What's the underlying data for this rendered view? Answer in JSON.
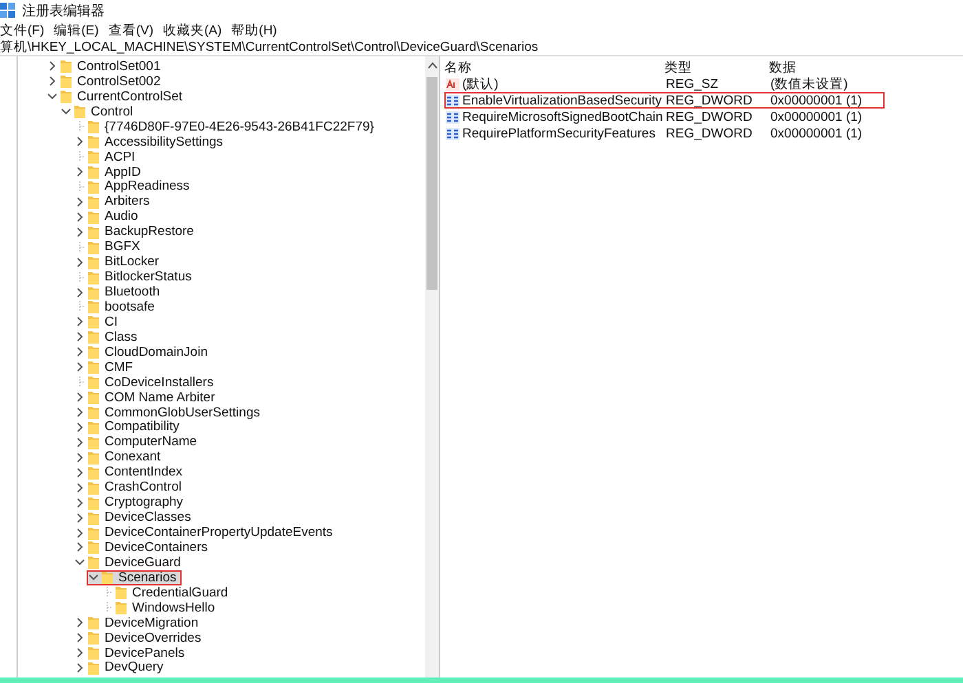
{
  "window": {
    "title": "注册表编辑器"
  },
  "menu": [
    "文件(F)",
    "编辑(E)",
    "查看(V)",
    "收藏夹(A)",
    "帮助(H)"
  ],
  "address": "算机\\HKEY_LOCAL_MACHINE\\SYSTEM\\CurrentControlSet\\Control\\DeviceGuard\\Scenarios",
  "tree": [
    {
      "label": "ControlSet001",
      "expandable": true,
      "expanded": false,
      "selected": false,
      "highlighted": false
    },
    {
      "label": "ControlSet002",
      "expandable": true,
      "expanded": false,
      "selected": false,
      "highlighted": false
    },
    {
      "label": "CurrentControlSet",
      "expandable": true,
      "expanded": true,
      "selected": false,
      "highlighted": false,
      "children": [
        {
          "label": "Control",
          "expandable": true,
          "expanded": true,
          "selected": false,
          "highlighted": false,
          "children": [
            {
              "label": "{7746D80F-97E0-4E26-9543-26B41FC22F79}",
              "expandable": false,
              "selected": false,
              "highlighted": false
            },
            {
              "label": "AccessibilitySettings",
              "expandable": true,
              "expanded": false,
              "selected": false,
              "highlighted": false
            },
            {
              "label": "ACPI",
              "expandable": false,
              "selected": false,
              "highlighted": false
            },
            {
              "label": "AppID",
              "expandable": true,
              "expanded": false,
              "selected": false,
              "highlighted": false
            },
            {
              "label": "AppReadiness",
              "expandable": false,
              "selected": false,
              "highlighted": false
            },
            {
              "label": "Arbiters",
              "expandable": true,
              "expanded": false,
              "selected": false,
              "highlighted": false
            },
            {
              "label": "Audio",
              "expandable": true,
              "expanded": false,
              "selected": false,
              "highlighted": false
            },
            {
              "label": "BackupRestore",
              "expandable": true,
              "expanded": false,
              "selected": false,
              "highlighted": false
            },
            {
              "label": "BGFX",
              "expandable": false,
              "selected": false,
              "highlighted": false
            },
            {
              "label": "BitLocker",
              "expandable": true,
              "expanded": false,
              "selected": false,
              "highlighted": false
            },
            {
              "label": "BitlockerStatus",
              "expandable": false,
              "selected": false,
              "highlighted": false
            },
            {
              "label": "Bluetooth",
              "expandable": true,
              "expanded": false,
              "selected": false,
              "highlighted": false
            },
            {
              "label": "bootsafe",
              "expandable": false,
              "selected": false,
              "highlighted": false
            },
            {
              "label": "CI",
              "expandable": true,
              "expanded": false,
              "selected": false,
              "highlighted": false
            },
            {
              "label": "Class",
              "expandable": true,
              "expanded": false,
              "selected": false,
              "highlighted": false
            },
            {
              "label": "CloudDomainJoin",
              "expandable": true,
              "expanded": false,
              "selected": false,
              "highlighted": false
            },
            {
              "label": "CMF",
              "expandable": true,
              "expanded": false,
              "selected": false,
              "highlighted": false
            },
            {
              "label": "CoDeviceInstallers",
              "expandable": false,
              "selected": false,
              "highlighted": false
            },
            {
              "label": "COM Name Arbiter",
              "expandable": true,
              "expanded": false,
              "selected": false,
              "highlighted": false
            },
            {
              "label": "CommonGlobUserSettings",
              "expandable": true,
              "expanded": false,
              "selected": false,
              "highlighted": false
            },
            {
              "label": "Compatibility",
              "expandable": true,
              "expanded": false,
              "selected": false,
              "highlighted": false
            },
            {
              "label": "ComputerName",
              "expandable": true,
              "expanded": false,
              "selected": false,
              "highlighted": false
            },
            {
              "label": "Conexant",
              "expandable": true,
              "expanded": false,
              "selected": false,
              "highlighted": false
            },
            {
              "label": "ContentIndex",
              "expandable": true,
              "expanded": false,
              "selected": false,
              "highlighted": false
            },
            {
              "label": "CrashControl",
              "expandable": true,
              "expanded": false,
              "selected": false,
              "highlighted": false
            },
            {
              "label": "Cryptography",
              "expandable": true,
              "expanded": false,
              "selected": false,
              "highlighted": false
            },
            {
              "label": "DeviceClasses",
              "expandable": true,
              "expanded": false,
              "selected": false,
              "highlighted": false
            },
            {
              "label": "DeviceContainerPropertyUpdateEvents",
              "expandable": true,
              "expanded": false,
              "selected": false,
              "highlighted": false
            },
            {
              "label": "DeviceContainers",
              "expandable": true,
              "expanded": false,
              "selected": false,
              "highlighted": false
            },
            {
              "label": "DeviceGuard",
              "expandable": true,
              "expanded": true,
              "selected": false,
              "highlighted": false,
              "children": [
                {
                  "label": "Scenarios",
                  "expandable": true,
                  "expanded": true,
                  "selected": true,
                  "highlighted": true,
                  "children": [
                    {
                      "label": "CredentialGuard",
                      "expandable": false,
                      "selected": false,
                      "highlighted": false
                    },
                    {
                      "label": "WindowsHello",
                      "expandable": false,
                      "selected": false,
                      "highlighted": false
                    }
                  ]
                }
              ]
            },
            {
              "label": "DeviceMigration",
              "expandable": true,
              "expanded": false,
              "selected": false,
              "highlighted": false
            },
            {
              "label": "DeviceOverrides",
              "expandable": true,
              "expanded": false,
              "selected": false,
              "highlighted": false
            },
            {
              "label": "DevicePanels",
              "expandable": true,
              "expanded": false,
              "selected": false,
              "highlighted": false
            },
            {
              "label": "DevQuery",
              "expandable": true,
              "expanded": false,
              "selected": false,
              "highlighted": false
            }
          ]
        }
      ]
    }
  ],
  "values": {
    "columns": [
      "名称",
      "类型",
      "数据"
    ],
    "rows": [
      {
        "kind": "string",
        "name": "(默认)",
        "type": "REG_SZ",
        "data": "(数值未设置)",
        "highlighted": false
      },
      {
        "kind": "dword",
        "name": "EnableVirtualizationBasedSecurity",
        "type": "REG_DWORD",
        "data": "0x00000001 (1)",
        "highlighted": true
      },
      {
        "kind": "dword",
        "name": "RequireMicrosoftSignedBootChain",
        "type": "REG_DWORD",
        "data": "0x00000001 (1)",
        "highlighted": false
      },
      {
        "kind": "dword",
        "name": "RequirePlatformSecurityFeatures",
        "type": "REG_DWORD",
        "data": "0x00000001 (1)",
        "highlighted": false
      }
    ]
  }
}
